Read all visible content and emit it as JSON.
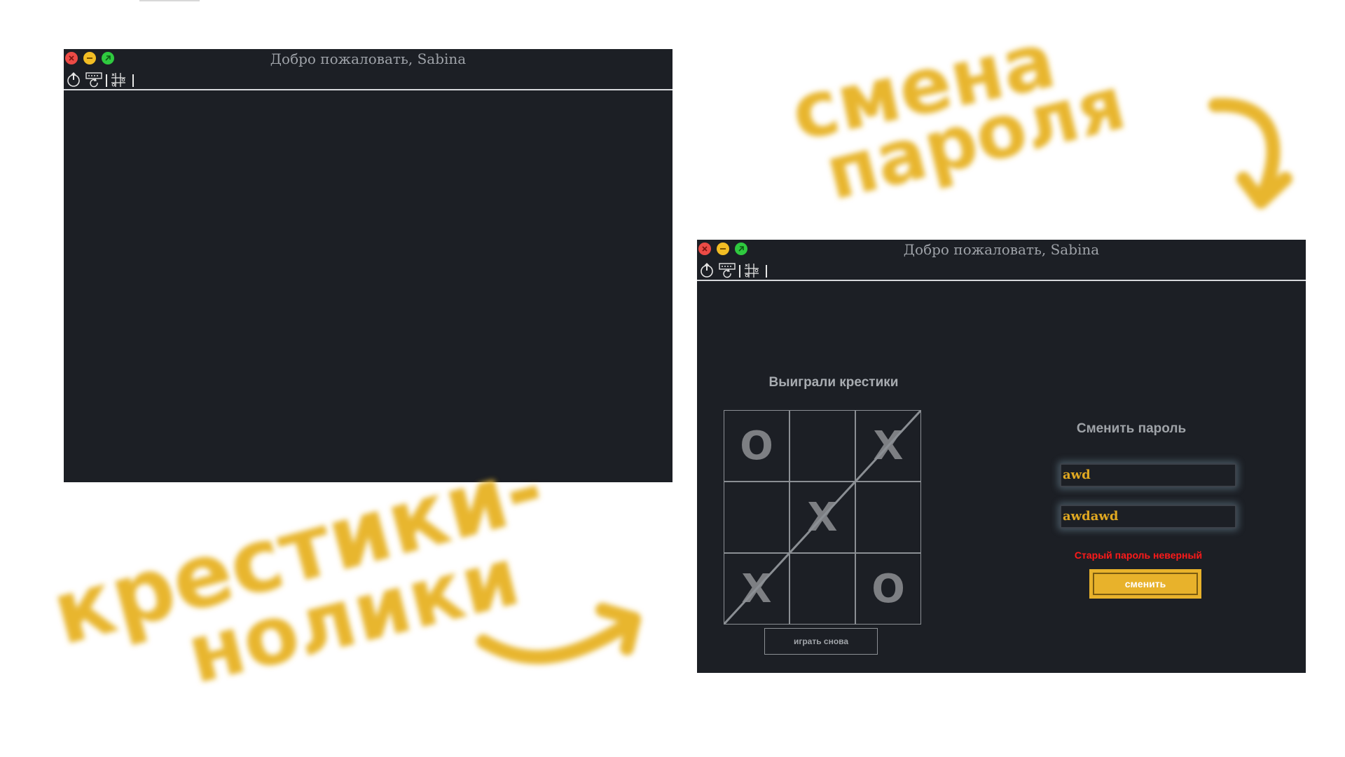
{
  "window_left": {
    "title": "Добро пожаловать, Sabina",
    "toolbar": {
      "icons": [
        "power-icon",
        "keyboard-refresh-icon",
        "tictactoe-grid-icon"
      ]
    }
  },
  "window_right": {
    "title": "Добро пожаловать, Sabina",
    "toolbar": {
      "icons": [
        "power-icon",
        "keyboard-refresh-icon",
        "tictactoe-grid-icon"
      ]
    },
    "game": {
      "status": "Выиграли крестики",
      "cells": [
        "O",
        "",
        "X",
        "",
        "X",
        "",
        "X",
        "",
        "O"
      ],
      "replay_label": "играть снова"
    },
    "password": {
      "title": "Сменить пароль",
      "old_value": "awd",
      "new_value": "awdawd",
      "error": "Старый пароль неверный",
      "submit_label": "сменить"
    }
  },
  "annotations": {
    "top_right": [
      "смена",
      "пароля"
    ],
    "bottom_left": [
      "крестики-",
      "нолики"
    ],
    "color": "#e8b62f"
  },
  "colors": {
    "window_bg": "#1c1f25",
    "accent": "#e8b22b",
    "error": "#ff1a1a"
  }
}
